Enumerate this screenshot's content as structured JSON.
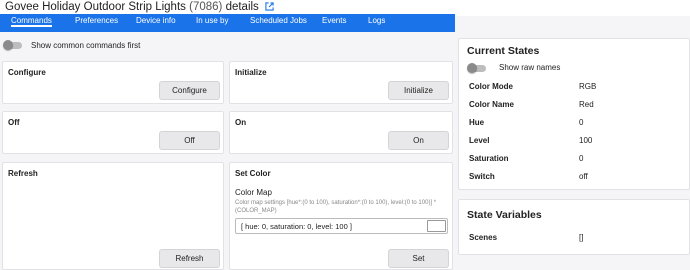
{
  "header": {
    "title": "Govee Holiday Outdoor Strip Lights",
    "device_id": "(7086)",
    "title_suffix": "details",
    "link_icon": "external-link-icon"
  },
  "tabs": [
    {
      "label": "Commands",
      "active": true
    },
    {
      "label": "Preferences",
      "active": false
    },
    {
      "label": "Device info",
      "active": false
    },
    {
      "label": "In use by",
      "active": false
    },
    {
      "label": "Scheduled Jobs",
      "active": false
    },
    {
      "label": "Events",
      "active": false
    },
    {
      "label": "Logs",
      "active": false
    }
  ],
  "commands": {
    "toggle_label": "Show common commands first",
    "cards": {
      "configure": {
        "title": "Configure",
        "button": "Configure"
      },
      "initialize": {
        "title": "Initialize",
        "button": "Initialize"
      },
      "off": {
        "title": "Off",
        "button": "Off"
      },
      "on": {
        "title": "On",
        "button": "On"
      },
      "refresh": {
        "title": "Refresh",
        "button": "Refresh"
      },
      "set_color": {
        "title": "Set Color",
        "field_label": "Color Map",
        "help": "Color map settings [hue*:(0 to 100), saturation*:(0 to 100), level:(0 to 100)] *(COLOR_MAP)",
        "value": "[ hue: 0, saturation: 0, level: 100 ]",
        "button": "Set"
      }
    }
  },
  "current_states": {
    "title": "Current States",
    "toggle_label": "Show raw names",
    "rows": [
      {
        "name": "Color Mode",
        "value": "RGB"
      },
      {
        "name": "Color Name",
        "value": "Red"
      },
      {
        "name": "Hue",
        "value": "0"
      },
      {
        "name": "Level",
        "value": "100"
      },
      {
        "name": "Saturation",
        "value": "0"
      },
      {
        "name": "Switch",
        "value": "off"
      }
    ]
  },
  "state_variables": {
    "title": "State Variables",
    "rows": [
      {
        "name": "Scenes",
        "value": "[]"
      }
    ]
  },
  "colors": {
    "tab_bar": "#1a73e8",
    "link": "#1a73e8",
    "button": "#e8e8ea"
  }
}
